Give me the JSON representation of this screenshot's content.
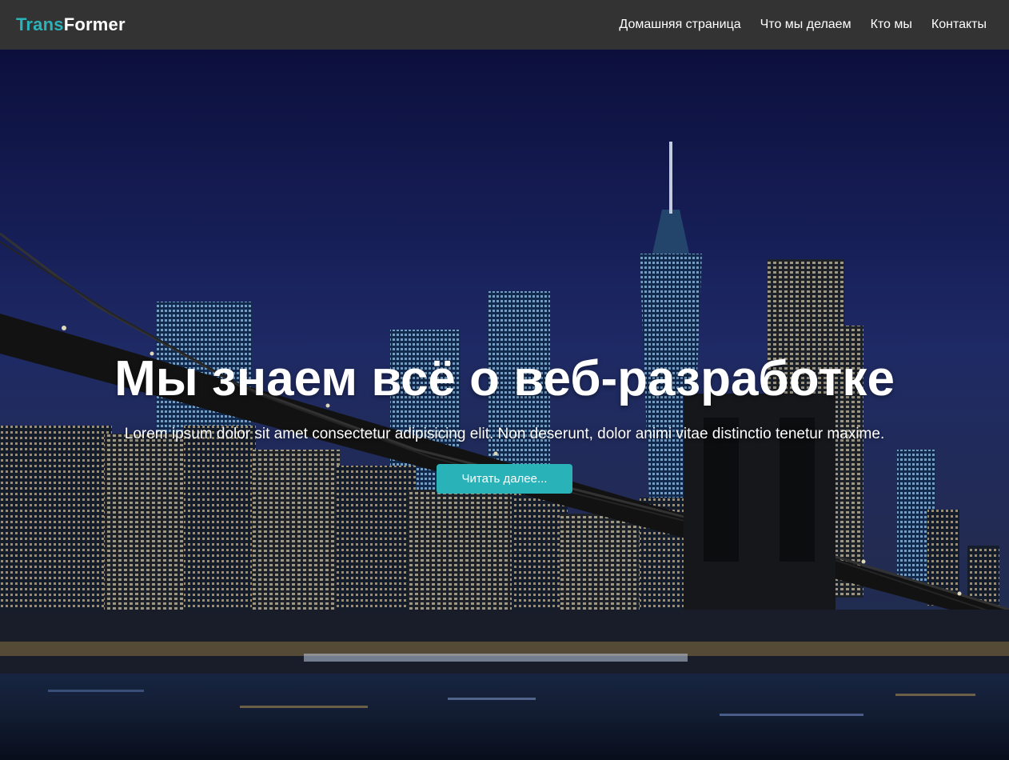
{
  "header": {
    "logo_part1": "Trans",
    "logo_part2": "Former",
    "nav": [
      {
        "label": "Домашняя страница"
      },
      {
        "label": "Что мы делаем"
      },
      {
        "label": "Кто мы"
      },
      {
        "label": "Контакты"
      }
    ]
  },
  "hero": {
    "title": "Мы знаем всё о веб-разработке",
    "text": "Lorem ipsum dolor sit amet consectetur adipisicing elit. Non deserunt, dolor animi vitae distinctio tenetur maxime.",
    "button_label": "Читать далее..."
  },
  "colors": {
    "accent": "#2ab3b9",
    "header_bg": "#333333",
    "text": "#ffffff"
  }
}
